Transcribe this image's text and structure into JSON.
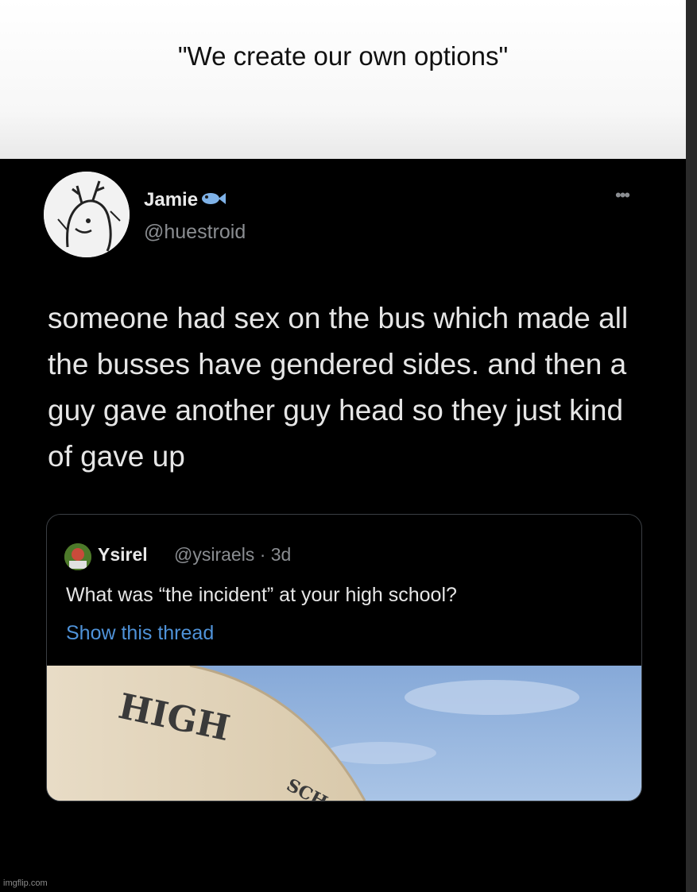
{
  "caption": {
    "text": "\"We create our own options\""
  },
  "tweet": {
    "author_name": "Jamie",
    "author_handle": "@huestroid",
    "more_icon": "ellipsis-icon",
    "text": "someone had sex on the bus which made all the busses have gendered sides. and then a guy gave another guy head so they just kind of gave up"
  },
  "quoted_tweet": {
    "author_name": "Ysirel",
    "author_handle": "@ysiraels · 3d",
    "text": "What was “the incident” at your high school?",
    "thread_link": "Show this thread",
    "image_sign_line1": "HIGH",
    "image_sign_line2": "SCH"
  },
  "watermark": "imgflip.com",
  "colors": {
    "link": "#4f92d8",
    "background": "#000000",
    "caption_bg": "#ffffff"
  }
}
